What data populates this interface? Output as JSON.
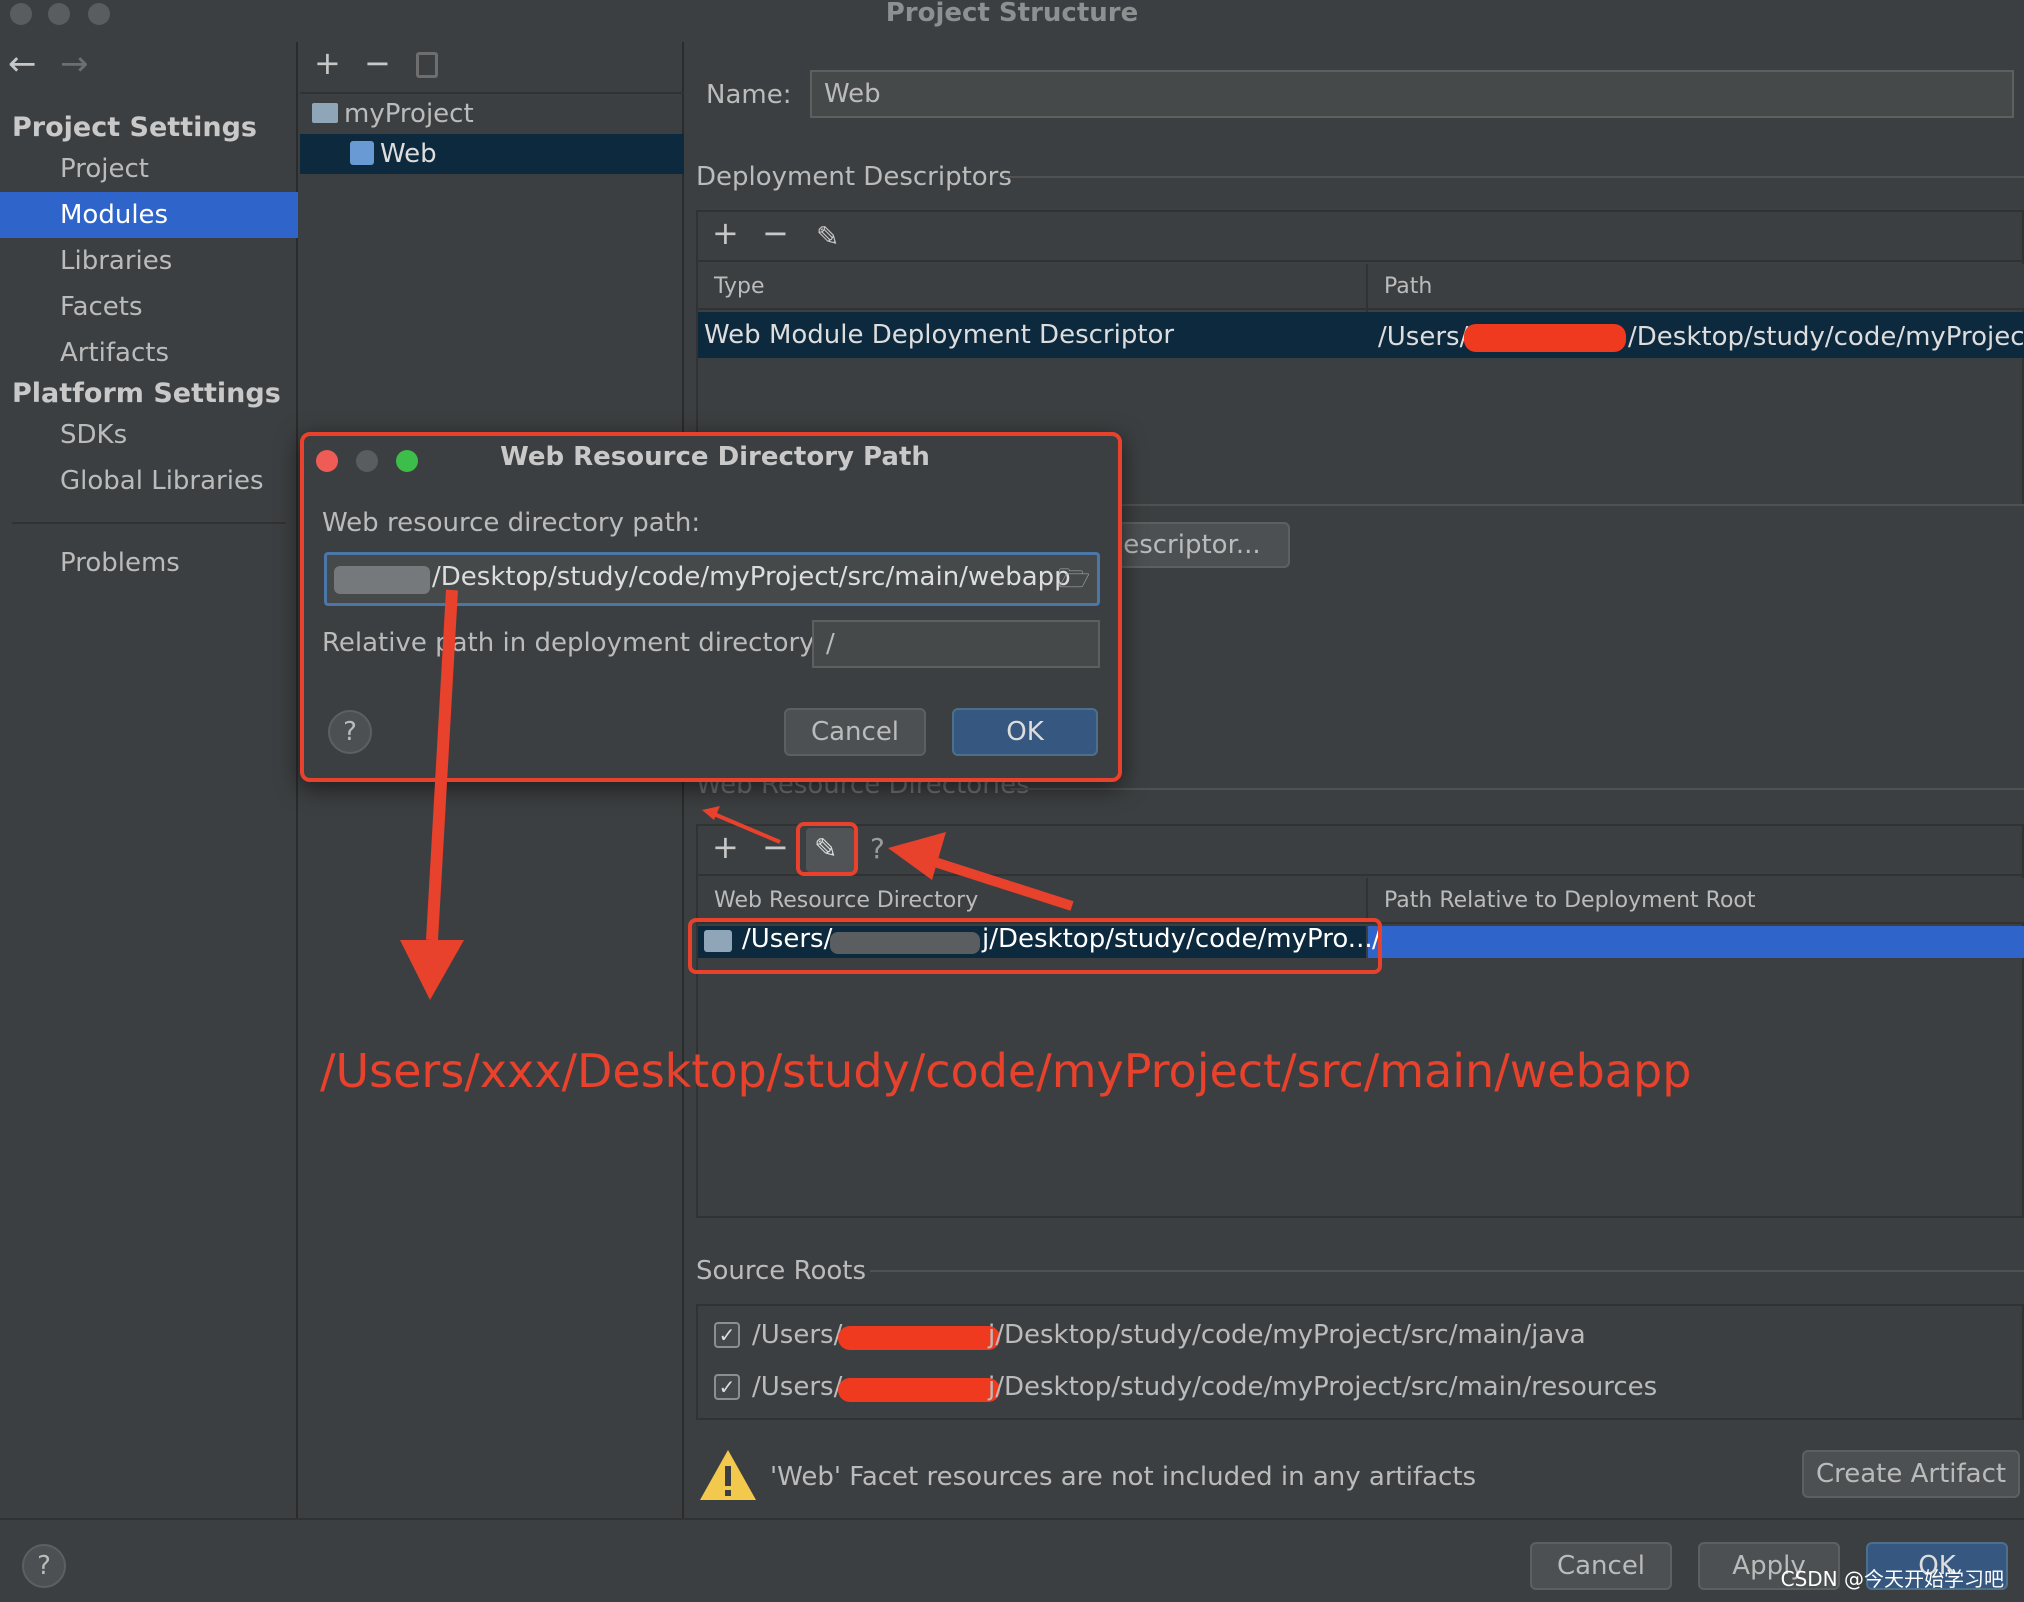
{
  "window": {
    "title": "Project Structure"
  },
  "nav": {
    "back_icon": "arrow-left-icon",
    "forward_icon": "arrow-right-icon",
    "project_settings_heading": "Project Settings",
    "project_items": [
      "Project",
      "Modules",
      "Libraries",
      "Facets",
      "Artifacts"
    ],
    "platform_settings_heading": "Platform Settings",
    "platform_items": [
      "SDKs",
      "Global Libraries"
    ],
    "problems": "Problems",
    "selected": "Modules"
  },
  "tree": {
    "toolbar": {
      "add": "+",
      "remove": "−",
      "copy_icon": "copy-icon"
    },
    "root": "myProject",
    "child": "Web"
  },
  "right": {
    "name_label": "Name:",
    "name_value": "Web",
    "deployment_descriptors": {
      "title": "Deployment Descriptors",
      "toolbar": {
        "add": "+",
        "remove": "−",
        "edit_icon": "pencil-icon"
      },
      "columns": [
        "Type",
        "Path"
      ],
      "row": {
        "type": "Web Module Deployment Descriptor",
        "path_start": "/Users/",
        "path_end": "/Desktop/study/code/myProject/s"
      },
      "add_button_partial": "lescriptor..."
    },
    "web_resource_directories": {
      "title_partial": "Web Resource Directories",
      "toolbar": {
        "add": "+",
        "remove": "−",
        "edit_icon": "pencil-icon",
        "help": "?"
      },
      "columns": [
        "Web Resource Directory",
        "Path Relative to Deployment Root"
      ],
      "row": {
        "dir_start": "/Users/",
        "dir_end": "j/Desktop/study/code/myPro...",
        "relative": "/"
      }
    },
    "source_roots": {
      "title": "Source Roots",
      "items": [
        {
          "start": "/Users/",
          "end": "j/Desktop/study/code/myProject/src/main/java",
          "checked": true
        },
        {
          "start": "/Users/",
          "end": "j/Desktop/study/code/myProject/src/main/resources",
          "checked": true
        }
      ]
    },
    "warning": {
      "icon": "warning-icon",
      "text": "'Web' Facet resources are not included in any artifacts"
    },
    "create_artifact": "Create Artifact"
  },
  "footer": {
    "help": "?",
    "cancel": "Cancel",
    "apply": "Apply",
    "ok": "OK"
  },
  "dialog": {
    "title": "Web Resource Directory Path",
    "path_label": "Web resource directory path:",
    "path_value": "/Desktop/study/code/myProject/src/main/webapp",
    "folder_icon": "folder-open-icon",
    "relative_label": "Relative path in deployment directory:",
    "relative_value": "/",
    "help": "?",
    "cancel": "Cancel",
    "ok": "OK"
  },
  "annotation": {
    "text": "/Users/xxx/Desktop/study/code/myProject/src/main/webapp",
    "color": "#e8412c"
  },
  "watermark": "CSDN @今天开始学习吧"
}
